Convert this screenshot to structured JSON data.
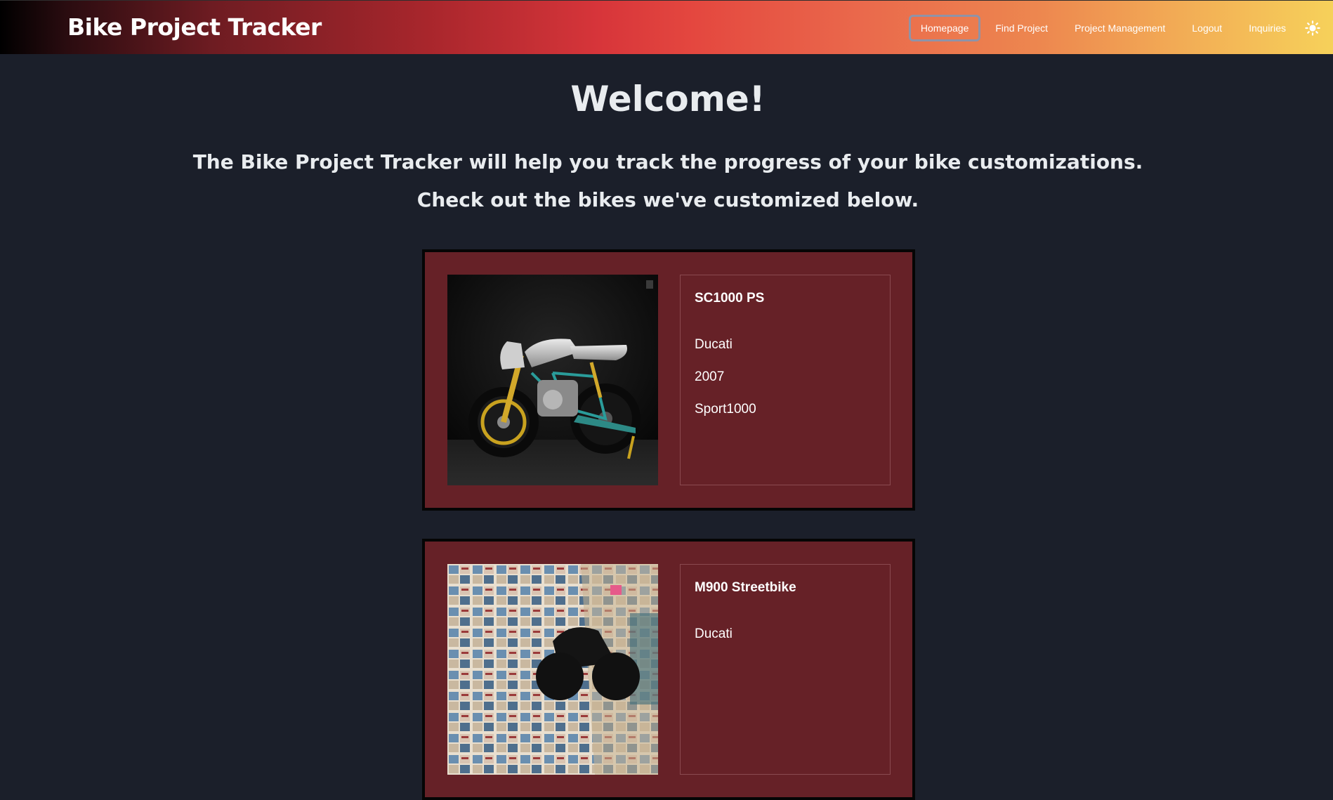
{
  "nav": {
    "brand": "Bike Project Tracker",
    "links": [
      "Homepage",
      "Find Project",
      "Project Management",
      "Logout",
      "Inquiries"
    ],
    "active": "Homepage",
    "theme_icon": "sun-icon"
  },
  "hero": {
    "title": "Welcome!",
    "line1": "The Bike Project Tracker will help you track the progress of your bike customizations.",
    "line2": "Check out the bikes we've customized below."
  },
  "bikes": [
    {
      "model": "SC1000 PS",
      "make": "Ducati",
      "year": "2007",
      "base": "Sport1000"
    },
    {
      "model": "M900 Streetbike",
      "make": "Ducati"
    }
  ],
  "colors": {
    "page_bg": "#1b1f2a",
    "card_bg": "#662127",
    "accent_gradient_start": "#000000",
    "accent_gradient_mid": "#e4473f",
    "accent_gradient_end": "#f6d15a"
  }
}
